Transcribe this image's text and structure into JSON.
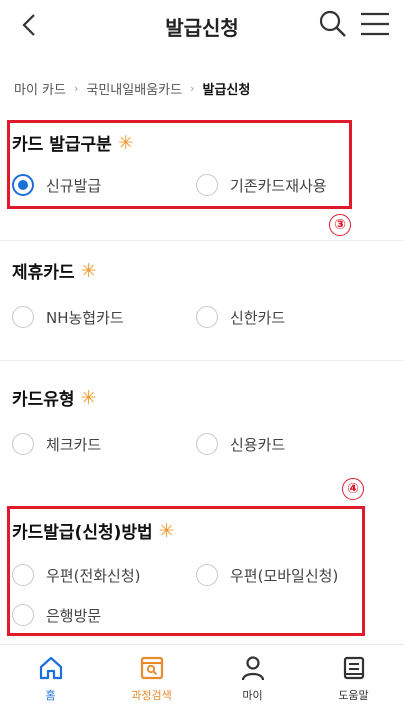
{
  "header": {
    "title": "발급신청"
  },
  "breadcrumb": {
    "items": [
      "마이 카드",
      "국민내일배움카드",
      "발급신청"
    ],
    "separator": "›"
  },
  "required_mark": "✳",
  "sections": [
    {
      "title": "카드 발급구분",
      "options": [
        {
          "label": "신규발급",
          "checked": true
        },
        {
          "label": "기존카드재사용",
          "checked": false
        }
      ]
    },
    {
      "title": "제휴카드",
      "options": [
        {
          "label": "NH농협카드",
          "checked": false
        },
        {
          "label": "신한카드",
          "checked": false
        }
      ]
    },
    {
      "title": "카드유형",
      "options": [
        {
          "label": "체크카드",
          "checked": false
        },
        {
          "label": "신용카드",
          "checked": false
        }
      ]
    },
    {
      "title": "카드발급(신청)방법",
      "options": [
        {
          "label": "우편(전화신청)",
          "checked": false
        },
        {
          "label": "우편(모바일신청)",
          "checked": false
        },
        {
          "label": "은행방문",
          "checked": false
        }
      ]
    }
  ],
  "markers": {
    "m3": "③",
    "m4": "④"
  },
  "bottom_nav": [
    {
      "label": "홈",
      "icon": "home-icon"
    },
    {
      "label": "과정검색",
      "icon": "course-search-icon"
    },
    {
      "label": "마이",
      "icon": "user-icon"
    },
    {
      "label": "도움말",
      "icon": "help-doc-icon"
    }
  ],
  "colors": {
    "accent": "#1a6fd9",
    "required": "#f29a2e",
    "highlight": "#e01a2a",
    "nav_search": "#e8892a"
  }
}
